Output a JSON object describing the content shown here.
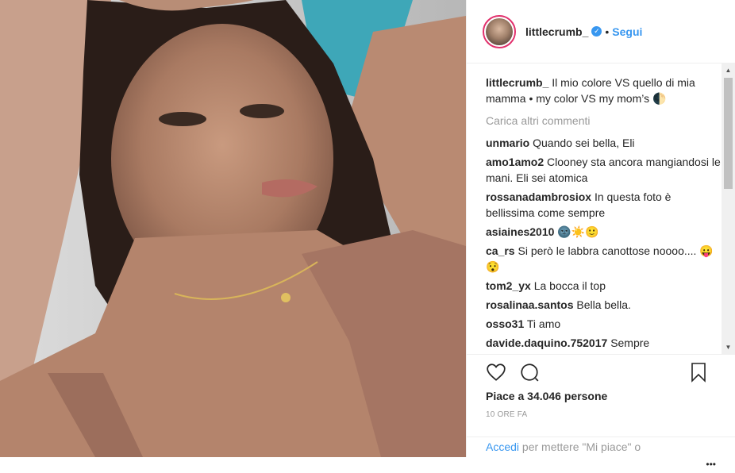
{
  "header": {
    "username": "littlecrumb_",
    "follow_label": "Segui",
    "separator": "•"
  },
  "caption": {
    "user": "littlecrumb_",
    "text": "Il mio colore VS quello di mia mamma • my color VS my mom’s 🌓"
  },
  "load_more_label": "Carica altri commenti",
  "comments": [
    {
      "user": "unmario",
      "text": "Quando sei bella, Eli"
    },
    {
      "user": "amo1amo2",
      "text": "Clooney sta ancora mangiandosi le mani. Eli sei atomica"
    },
    {
      "user": "rossanadambrosiox",
      "text": "In questa foto è bellissima come sempre"
    },
    {
      "user": "asiaines2010",
      "text": "🌚☀️🙂"
    },
    {
      "user": "ca_rs",
      "text": "Si però le labbra canottose noooo.... 😛😯"
    },
    {
      "user": "tom2_yx",
      "text": "La bocca il top"
    },
    {
      "user": "rosalinaa.santos",
      "text": "Bella bella."
    },
    {
      "user": "osso31",
      "text": "Ti amo"
    },
    {
      "user": "davide.daquino.752017",
      "text": "Sempre"
    }
  ],
  "likes_text": "Piace a 34.046 persone",
  "timestamp": "10 ORE FA",
  "login": {
    "link": "Accedi",
    "rest": " per mettere \"Mi piace\" o"
  },
  "icons": {
    "like": "heart-icon",
    "comment": "comment-icon",
    "save": "bookmark-icon",
    "more": "more-icon"
  }
}
